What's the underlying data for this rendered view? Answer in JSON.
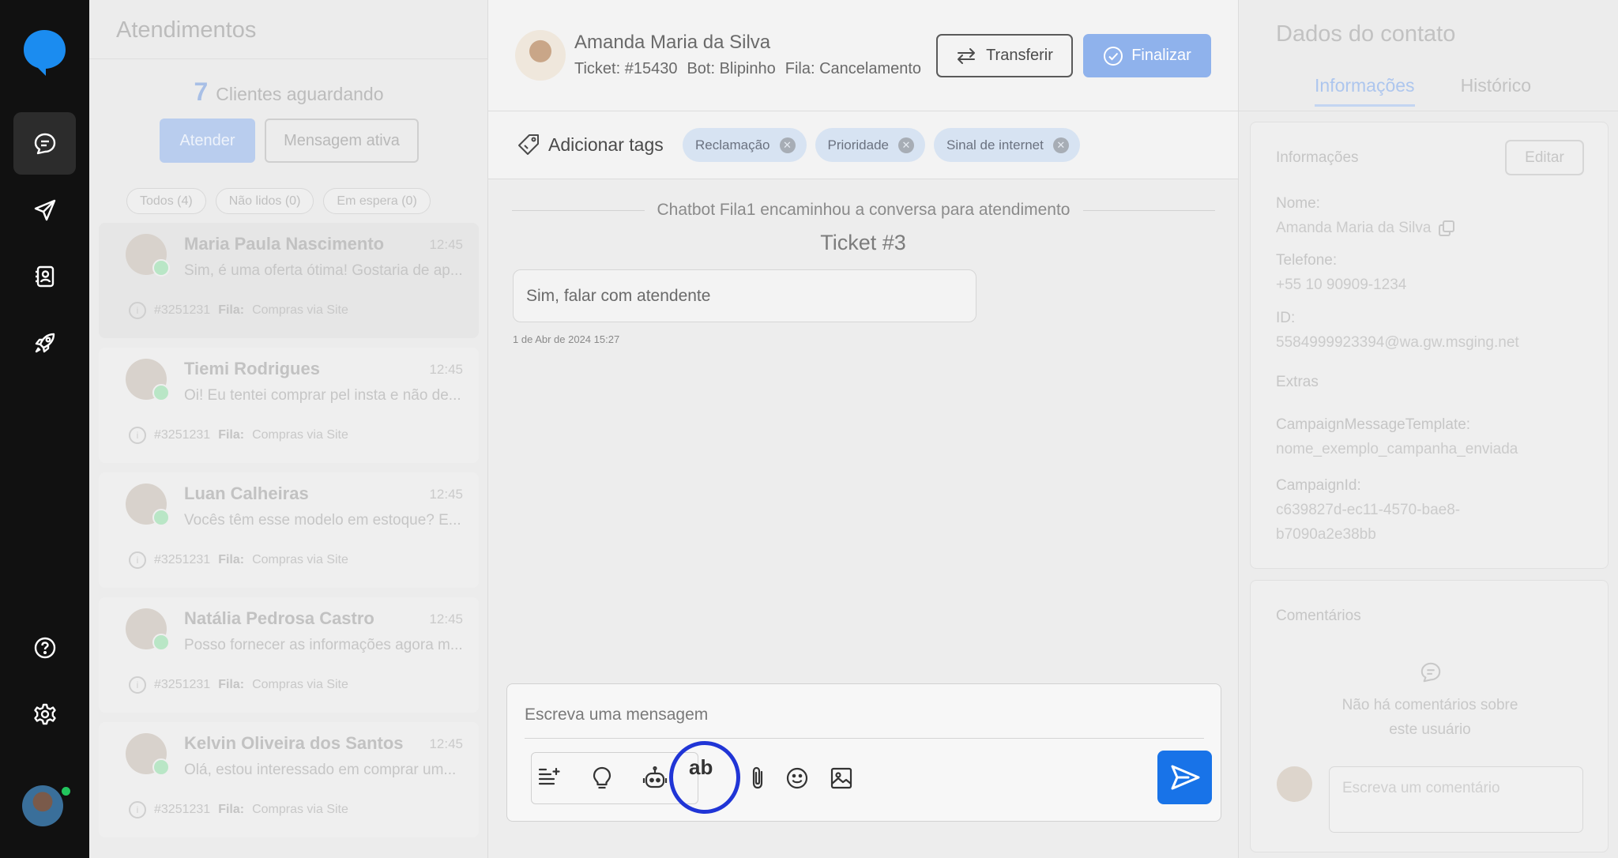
{
  "colors": {
    "brand_blue": "#1873e8",
    "finalize_blue": "#8fb2ec",
    "ring_highlight": "#2035d6",
    "rail_bg": "#111111"
  },
  "rail": {
    "icons": [
      "chat-icon",
      "send-icon",
      "contacts-icon",
      "rocket-icon",
      "help-icon",
      "settings-icon"
    ]
  },
  "attendances": {
    "title": "Atendimentos",
    "waiting_count": "7",
    "waiting_label": "Clientes aguardando",
    "attend_button": "Atender",
    "active_message_button": "Mensagem ativa",
    "filters": [
      "Todos (4)",
      "Não lidos (0)",
      "Em espera (0)"
    ],
    "items": [
      {
        "name": "Maria Paula Nascimento",
        "time": "12:45",
        "preview": "Sim, é uma oferta ótima! Gostaria de ap...",
        "ticket": "#3251231",
        "queue_label": "Fila:",
        "queue": "Compras via Site"
      },
      {
        "name": "Tiemi Rodrigues",
        "time": "12:45",
        "preview": "Oi! Eu tentei comprar pel insta e não de...",
        "ticket": "#3251231",
        "queue_label": "Fila:",
        "queue": "Compras via Site"
      },
      {
        "name": "Luan Calheiras",
        "time": "12:45",
        "preview": "Vocês têm esse modelo em estoque? E...",
        "ticket": "#3251231",
        "queue_label": "Fila:",
        "queue": "Compras via Site"
      },
      {
        "name": "Natália Pedrosa Castro",
        "time": "12:45",
        "preview": "Posso fornecer as informações agora m...",
        "ticket": "#3251231",
        "queue_label": "Fila:",
        "queue": "Compras via Site"
      },
      {
        "name": "Kelvin Oliveira dos Santos",
        "time": "12:45",
        "preview": "Olá, estou interessado em comprar um...",
        "ticket": "#3251231",
        "queue_label": "Fila:",
        "queue": "Compras via Site"
      }
    ]
  },
  "chat": {
    "contact_name": "Amanda Maria da Silva",
    "ticket": "Ticket: #15430",
    "bot": "Bot: Blipinho",
    "queue": "Fila: Cancelamento",
    "transfer_button": "Transferir",
    "finalize_button": "Finalizar",
    "add_tags_label": "Adicionar tags",
    "tags": [
      "Reclamação",
      "Prioridade",
      "Sinal de internet"
    ],
    "system_message": "Chatbot Fila1 encaminhou a conversa para atendimento",
    "ticket_title": "Ticket #3",
    "message": "Sim, falar com atendente",
    "message_timestamp": "1 de Abr de 2024 15:27",
    "composer_placeholder": "Escreva uma mensagem",
    "text_format_label": "ab"
  },
  "contact": {
    "title": "Dados do contato",
    "tabs": [
      "Informações",
      "Histórico"
    ],
    "section_title": "Informações",
    "edit_button": "Editar",
    "name_label": "Nome:",
    "name_value": "Amanda Maria da Silva",
    "phone_label": "Telefone:",
    "phone_value": "+55 10 90909-1234",
    "id_label": "ID:",
    "id_value": "5584999923394@wa.gw.msging.net",
    "extras_label": "Extras",
    "campaign_template_label": "CampaignMessageTemplate:",
    "campaign_template_value": "nome_exemplo_campanha_enviada",
    "campaign_id_label": "CampaignId:",
    "campaign_id_value_line1": "c639827d-ec11-4570-bae8-",
    "campaign_id_value_line2": "b7090a2e38bb",
    "comments_title": "Comentários",
    "no_comments_line1": "Não há comentários sobre",
    "no_comments_line2": "este usuário",
    "comment_placeholder": "Escreva um comentário"
  }
}
